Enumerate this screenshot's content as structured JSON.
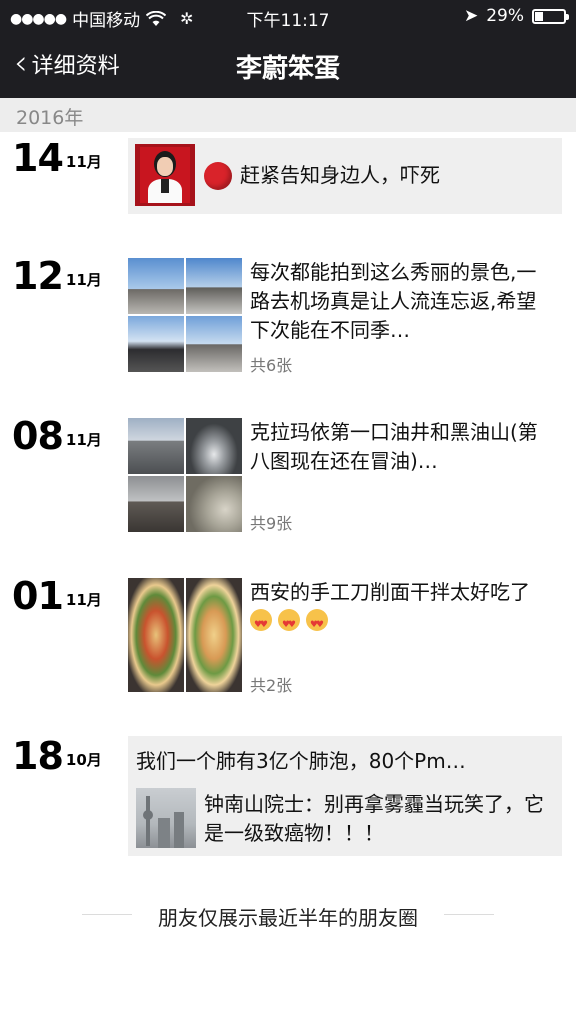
{
  "status": {
    "carrier": "中国移动",
    "time": "下午11:17",
    "battery": "29%",
    "battery_level": 0.29
  },
  "nav": {
    "back_label": "详细资料",
    "title": "李蔚笨蛋"
  },
  "year": "2016年",
  "entries": [
    {
      "day": "14",
      "month": "11月",
      "text": "赶紧告知身边人，吓死"
    },
    {
      "day": "12",
      "month": "11月",
      "text": "每次都能拍到这么秀丽的景色,一路去机场真是让人流连忘返,希望下次能在不同季…",
      "count": "共6张"
    },
    {
      "day": "08",
      "month": "11月",
      "text": "克拉玛依第一口油井和黑油山(第八图现在还在冒油)…",
      "count": "共9张"
    },
    {
      "day": "01",
      "month": "11月",
      "text": "西安的手工刀削面干拌太好吃了",
      "count": "共2张"
    },
    {
      "day": "18",
      "month": "10月",
      "text": "我们一个肺有3亿个肺泡，80个Pm…",
      "link_text": "钟南山院士：别再拿雾霾当玩笑了，它是一级致癌物！！！"
    }
  ],
  "footer": "朋友仅展示最近半年的朋友圈",
  "colors": {
    "header_bg": "#1e1e22",
    "card_bg": "#efefef",
    "year_bar_bg": "#ededed"
  }
}
